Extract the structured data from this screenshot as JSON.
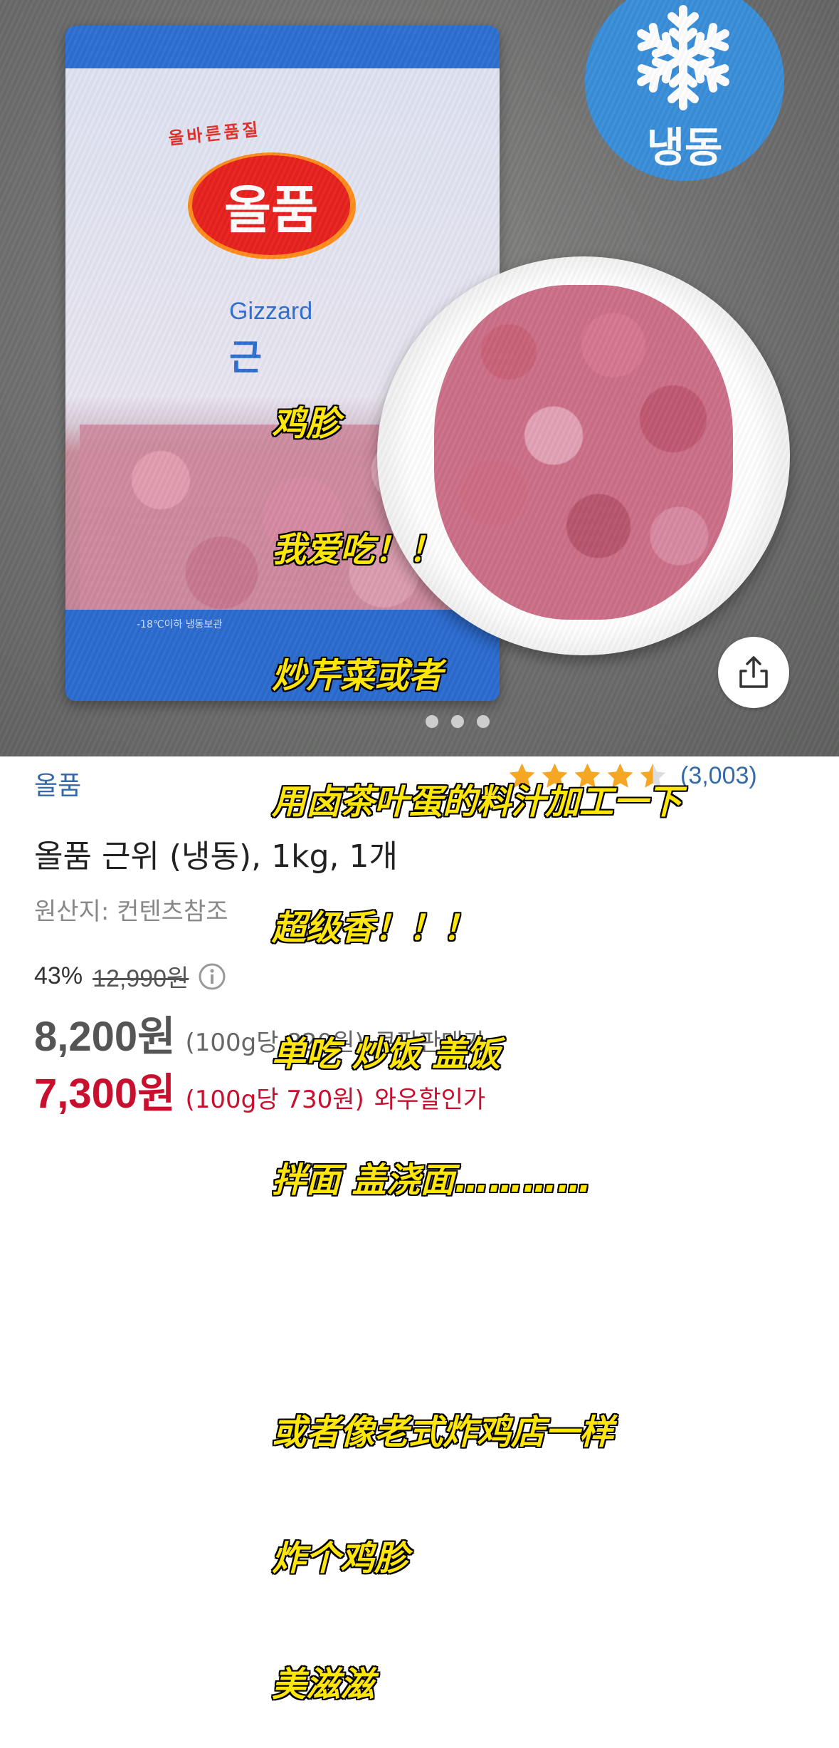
{
  "image": {
    "bag": {
      "tagline": "올바른품질",
      "logo_name": "올품",
      "product_en": "Gizzard",
      "product_kr": "근",
      "bottom_label": "-18℃이하 냉동보관"
    },
    "frozen_badge": {
      "icon": "snowflake-icon",
      "label": "냉동",
      "color": "#3a8ed9"
    },
    "overlay_lines": [
      "鸡胗",
      "我爱吃！！",
      "炒芹菜或者",
      "用卤茶叶蛋的料汁加工一下",
      "超级香！！！",
      "单吃 炒饭 盖饭",
      "拌面 盖浇面…………",
      "",
      "或者像老式炸鸡店一样",
      "炸个鸡胗",
      "美滋滋"
    ],
    "overlay_color": "#ffe60a",
    "share_icon": "share-icon",
    "carousel_dots": 3
  },
  "product": {
    "brand": "올품",
    "rating": 4.5,
    "review_count": "(3,003)",
    "title": "올품 근위 (냉동), 1kg, 1개",
    "origin": "원산지: 컨텐츠참조"
  },
  "pricing": {
    "discount_rate": "43%",
    "original_price": "12,990원",
    "info_icon": "info-icon",
    "sale_price": "8,200원",
    "sale_unit": "(100g당 820원)",
    "sale_label": "쿠팡판매가",
    "wow_price": "7,300원",
    "wow_unit": "(100g당 730원)",
    "wow_label": "와우할인가",
    "wow_color": "#c8102e",
    "star_color": "#f5a623"
  }
}
